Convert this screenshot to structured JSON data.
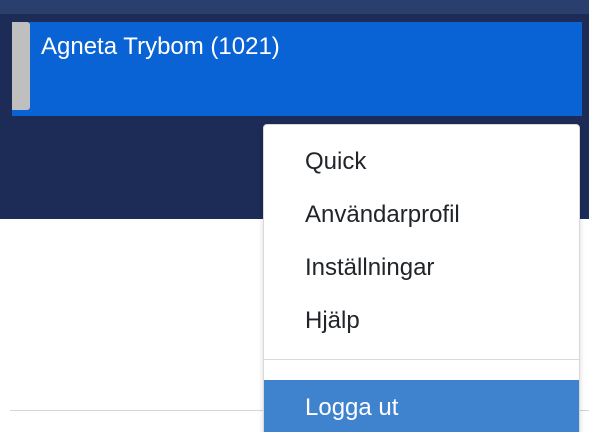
{
  "header": {
    "user_label": "Agneta Trybom (1021)"
  },
  "menu": {
    "items": [
      {
        "label": "Quick"
      },
      {
        "label": "Användarprofil"
      },
      {
        "label": "Inställningar"
      },
      {
        "label": "Hjälp"
      }
    ],
    "logout_label": "Logga ut"
  },
  "colors": {
    "header_bg": "#1c2c57",
    "user_card_bg": "#0a63d4",
    "logout_highlight": "#3f83cf"
  }
}
